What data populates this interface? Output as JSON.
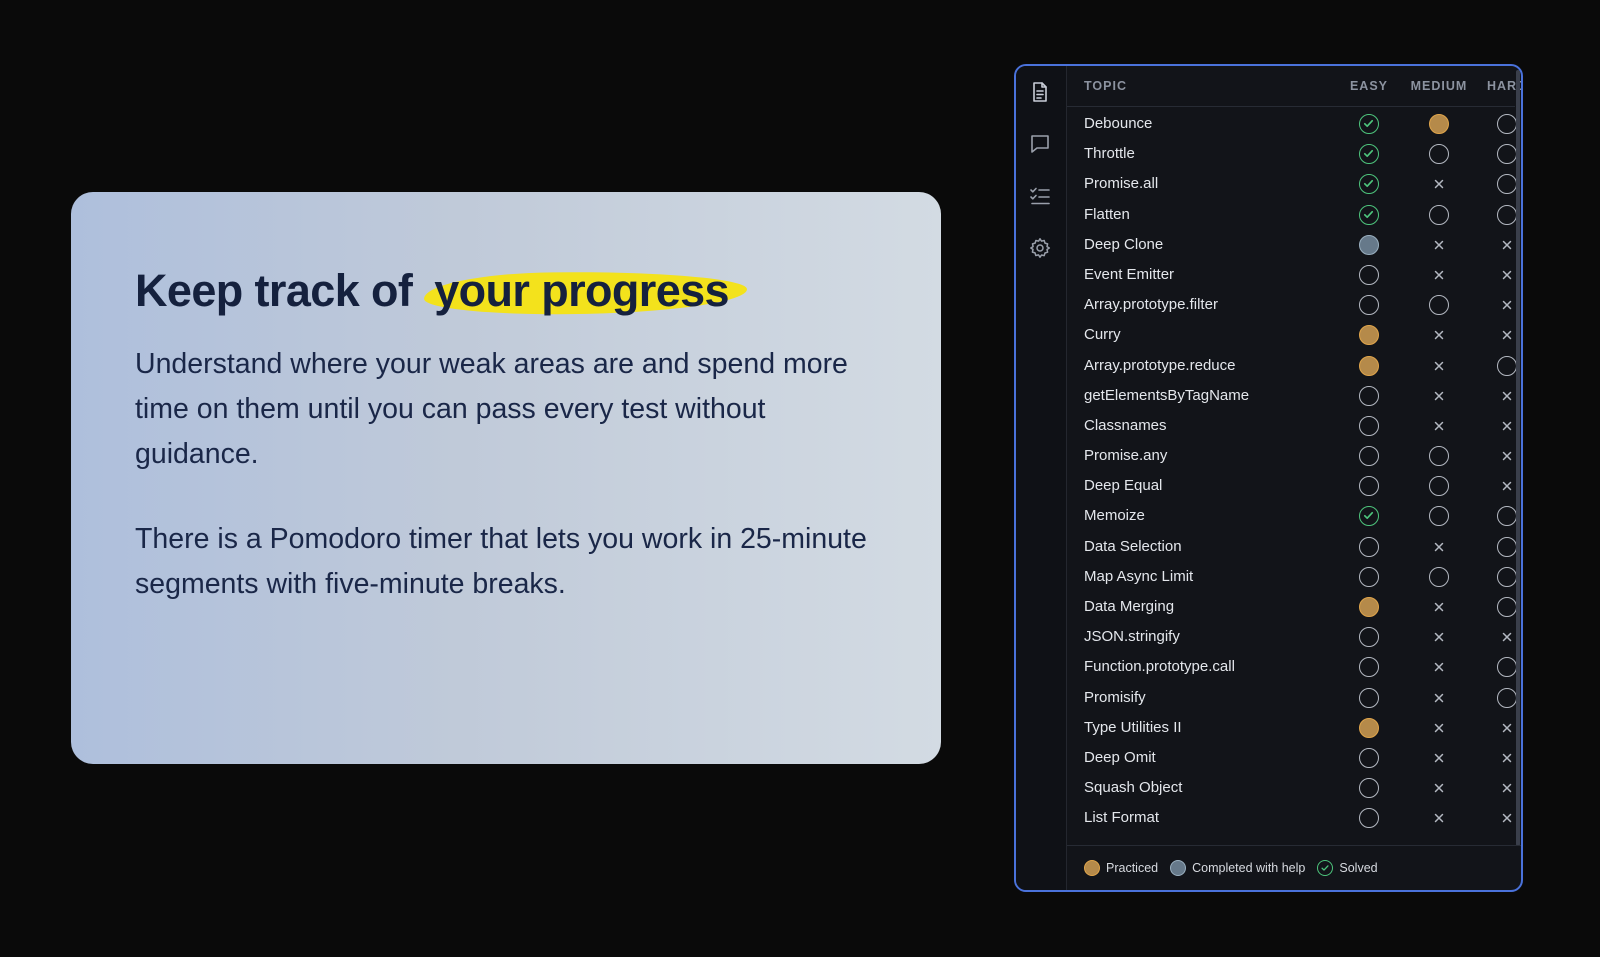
{
  "card": {
    "headline_prefix": "Keep track of",
    "headline_highlight": "your progress",
    "paragraph1": "Understand where your weak areas are and spend more time on them until you can pass every test without guidance.",
    "paragraph2": "There is a Pomodoro timer that lets you work in 25-minute segments with five-minute breaks.",
    "highlight_color": "#f3e21c"
  },
  "sidebar": {
    "icons": [
      "document-icon",
      "chat-icon",
      "checklist-icon",
      "gear-icon"
    ],
    "active": "document-icon"
  },
  "table": {
    "headers": {
      "topic": "TOPIC",
      "easy": "EASY",
      "medium": "MEDIUM",
      "hard": "HARD"
    },
    "rows": [
      {
        "topic": "Debounce",
        "easy": "solved",
        "medium": "practiced",
        "hard": "none"
      },
      {
        "topic": "Throttle",
        "easy": "solved",
        "medium": "none",
        "hard": "none"
      },
      {
        "topic": "Promise.all",
        "easy": "solved",
        "medium": "unavailable",
        "hard": "none"
      },
      {
        "topic": "Flatten",
        "easy": "solved",
        "medium": "none",
        "hard": "none"
      },
      {
        "topic": "Deep Clone",
        "easy": "help",
        "medium": "unavailable",
        "hard": "unavailable"
      },
      {
        "topic": "Event Emitter",
        "easy": "none",
        "medium": "unavailable",
        "hard": "unavailable"
      },
      {
        "topic": "Array.prototype.filter",
        "easy": "none",
        "medium": "none",
        "hard": "unavailable"
      },
      {
        "topic": "Curry",
        "easy": "practiced",
        "medium": "unavailable",
        "hard": "unavailable"
      },
      {
        "topic": "Array.prototype.reduce",
        "easy": "practiced",
        "medium": "unavailable",
        "hard": "none"
      },
      {
        "topic": "getElementsByTagName",
        "easy": "none",
        "medium": "unavailable",
        "hard": "unavailable"
      },
      {
        "topic": "Classnames",
        "easy": "none",
        "medium": "unavailable",
        "hard": "unavailable"
      },
      {
        "topic": "Promise.any",
        "easy": "none",
        "medium": "none",
        "hard": "unavailable"
      },
      {
        "topic": "Deep Equal",
        "easy": "none",
        "medium": "none",
        "hard": "unavailable"
      },
      {
        "topic": "Memoize",
        "easy": "solved",
        "medium": "none",
        "hard": "none"
      },
      {
        "topic": "Data Selection",
        "easy": "none",
        "medium": "unavailable",
        "hard": "none"
      },
      {
        "topic": "Map Async Limit",
        "easy": "none",
        "medium": "none",
        "hard": "none"
      },
      {
        "topic": "Data Merging",
        "easy": "practiced",
        "medium": "unavailable",
        "hard": "none"
      },
      {
        "topic": "JSON.stringify",
        "easy": "none",
        "medium": "unavailable",
        "hard": "unavailable"
      },
      {
        "topic": "Function.prototype.call",
        "easy": "none",
        "medium": "unavailable",
        "hard": "none"
      },
      {
        "topic": "Promisify",
        "easy": "none",
        "medium": "unavailable",
        "hard": "none"
      },
      {
        "topic": "Type Utilities II",
        "easy": "practiced",
        "medium": "unavailable",
        "hard": "unavailable"
      },
      {
        "topic": "Deep Omit",
        "easy": "none",
        "medium": "unavailable",
        "hard": "unavailable"
      },
      {
        "topic": "Squash Object",
        "easy": "none",
        "medium": "unavailable",
        "hard": "unavailable"
      },
      {
        "topic": "List Format",
        "easy": "none",
        "medium": "unavailable",
        "hard": "unavailable"
      }
    ]
  },
  "legend": {
    "practiced": "Practiced",
    "help": "Completed with help",
    "solved": "Solved"
  },
  "colors": {
    "practiced": "#b58a4a",
    "help": "#66798a",
    "solved": "#4dc47c",
    "panel_border": "#4a72db"
  }
}
